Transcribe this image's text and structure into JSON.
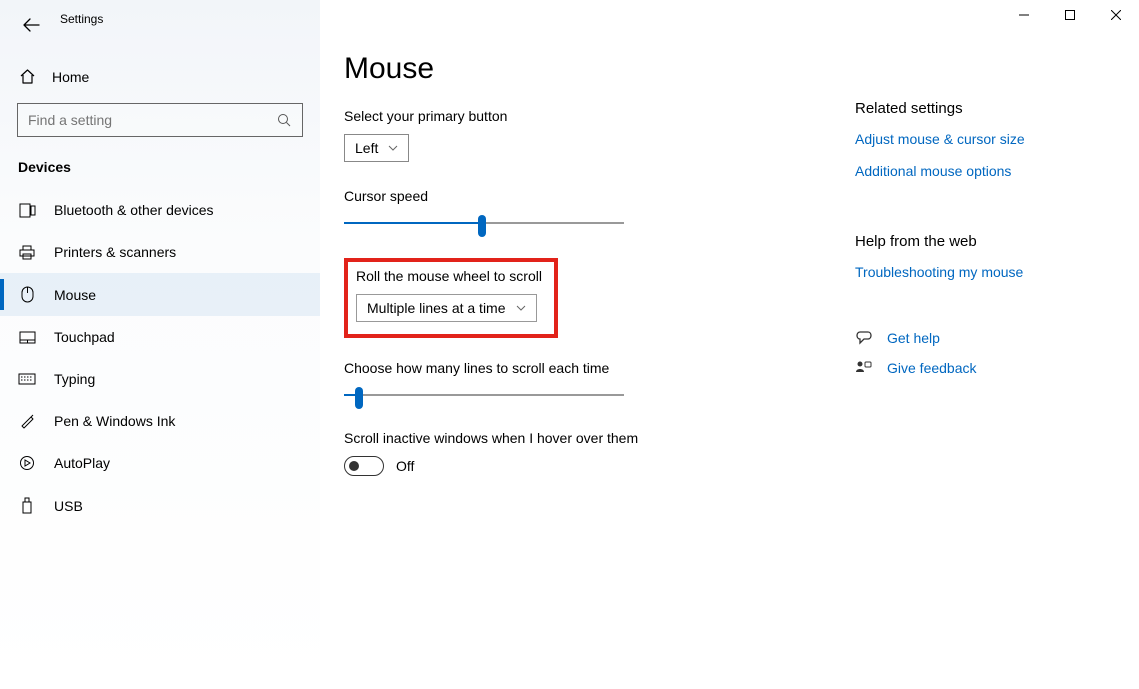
{
  "window": {
    "app_title": "Settings"
  },
  "sidebar": {
    "home_label": "Home",
    "search_placeholder": "Find a setting",
    "section": "Devices",
    "items": [
      {
        "label": "Bluetooth & other devices"
      },
      {
        "label": "Printers & scanners"
      },
      {
        "label": "Mouse"
      },
      {
        "label": "Touchpad"
      },
      {
        "label": "Typing"
      },
      {
        "label": "Pen & Windows Ink"
      },
      {
        "label": "AutoPlay"
      },
      {
        "label": "USB"
      }
    ]
  },
  "page": {
    "title": "Mouse",
    "primary_button_label": "Select your primary button",
    "primary_button_value": "Left",
    "cursor_speed_label": "Cursor speed",
    "cursor_speed_percent": 48,
    "scroll_mode_label": "Roll the mouse wheel to scroll",
    "scroll_mode_value": "Multiple lines at a time",
    "lines_label": "Choose how many lines to scroll each time",
    "lines_percent": 4,
    "inactive_label": "Scroll inactive windows when I hover over them",
    "inactive_state": "Off"
  },
  "right": {
    "related_heading": "Related settings",
    "link_adjust": "Adjust mouse & cursor size",
    "link_additional": "Additional mouse options",
    "help_heading": "Help from the web",
    "link_troubleshoot": "Troubleshooting my mouse",
    "get_help": "Get help",
    "give_feedback": "Give feedback"
  }
}
